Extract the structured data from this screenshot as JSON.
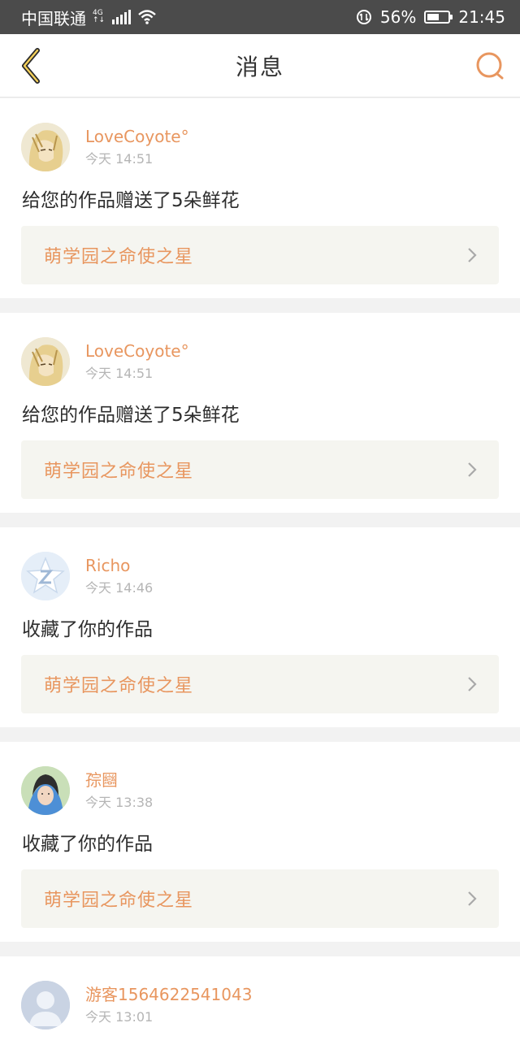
{
  "status_bar": {
    "carrier": "中国联通",
    "network": "4G",
    "network_sub": "↑↓",
    "battery_percent": "56%",
    "battery_level": 0.56,
    "time": "21:45"
  },
  "header": {
    "title": "消息",
    "back_icon": "chevron-left-icon",
    "search_icon": "search-icon",
    "accent_color": "#e8965f"
  },
  "messages": [
    {
      "username": "LoveCoyote°",
      "time": "今天 14:51",
      "action": "给您的作品赠送了5朵鲜花",
      "work_title": "萌学园之命使之星",
      "avatar": "anime-avatar"
    },
    {
      "username": "LoveCoyote°",
      "time": "今天 14:51",
      "action": "给您的作品赠送了5朵鲜花",
      "work_title": "萌学园之命使之星",
      "avatar": "anime-avatar"
    },
    {
      "username": "Richo",
      "time": "今天 14:46",
      "action": "收藏了你的作品",
      "work_title": "萌学园之命使之星",
      "avatar": "star-z-avatar"
    },
    {
      "username": "孮圝",
      "time": "今天 13:38",
      "action": "收藏了你的作品",
      "work_title": "萌学园之命使之星",
      "avatar": "photo-avatar"
    },
    {
      "username": "游客1564622541043",
      "time": "今天 13:01",
      "avatar": "default-user-avatar"
    }
  ]
}
